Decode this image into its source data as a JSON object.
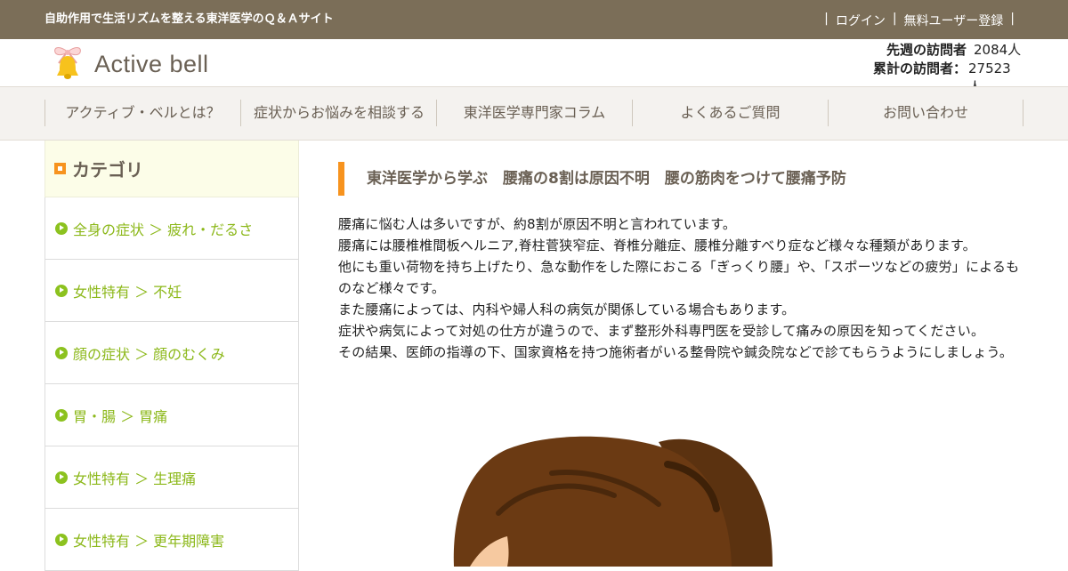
{
  "topbar": {
    "tagline": "自助作用で生活リズムを整える東洋医学のＱ＆Ａサイト",
    "login": "ログイン",
    "register": "無料ユーザー登録",
    "separator": "|"
  },
  "header": {
    "logo_text": "Active bell",
    "visitors": {
      "last_week_label": "先週の訪問者",
      "last_week_value": "2084人",
      "total_label": "累計の訪問者：",
      "total_value": "27523人"
    }
  },
  "nav": {
    "items": [
      "アクティブ・ベルとは？",
      "症状からお悩みを相談する",
      "東洋医学専門家コラム",
      "よくあるご質問",
      "お問い合わせ"
    ]
  },
  "sidebar": {
    "heading": "カテゴリ",
    "items": [
      "全身の症状 ＞ 疲れ・だるさ",
      "女性特有 ＞ 不妊",
      "顔の症状 ＞ 顔のむくみ",
      "胃・腸 ＞ 胃痛",
      "女性特有 ＞ 生理痛",
      "女性特有 ＞ 更年期障害"
    ]
  },
  "article": {
    "title": "東洋医学から学ぶ　腰痛の8割は原因不明　腰の筋肉をつけて腰痛予防",
    "paragraphs": [
      "腰痛に悩む人は多いですが、約8割が原因不明と言われています。",
      "腰痛には腰椎椎間板ヘルニア,脊柱菅狭窄症、脊椎分離症、腰椎分離すべり症など様々な種類があります。",
      "他にも重い荷物を持ち上げたり、急な動作をした際におこる「ぎっくり腰」や、「スポーツなどの疲労」によるものなど様々です。",
      "また腰痛によっては、内科や婦人科の病気が関係している場合もあります。",
      "症状や病気によって対処の仕方が違うので、まず整形外科専門医を受診して痛みの原因を知ってください。",
      "その結果、医師の指導の下、国家資格を持つ施術者がいる整骨院や鍼灸院などで診てもらうようにしましょう。"
    ]
  },
  "colors": {
    "topbar": "#7b6e58",
    "accent_orange": "#f7931e",
    "category_green": "#8cb81a"
  }
}
